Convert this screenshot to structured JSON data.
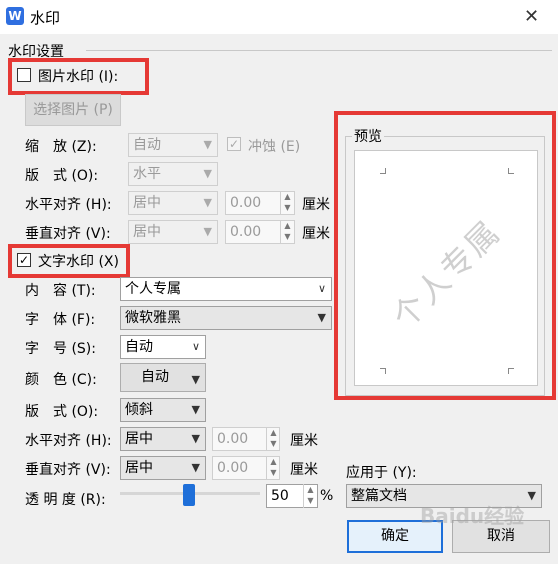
{
  "window": {
    "title": "水印",
    "app_icon": "W",
    "close": "✕"
  },
  "settings_group": {
    "title": "水印设置"
  },
  "picture_watermark": {
    "label": "图片水印 (I):",
    "checked": false,
    "select_picture_button": "选择图片 (P)",
    "scale_label": "缩　放 (Z):",
    "scale_value": "自动",
    "washout_label": "冲蚀 (E)",
    "washout_checked": true,
    "layout_label": "版　式 (O):",
    "layout_value": "水平",
    "h_align_label": "水平对齐 (H):",
    "h_align_value": "居中",
    "h_offset": "0.00",
    "h_unit": "厘米",
    "v_align_label": "垂直对齐 (V):",
    "v_align_value": "居中",
    "v_offset": "0.00",
    "v_unit": "厘米"
  },
  "text_watermark": {
    "label": "文字水印 (X)",
    "checked": true,
    "content_label": "内　容 (T):",
    "content_value": "个人专属",
    "font_label": "字　体 (F):",
    "font_value": "微软雅黑",
    "size_label": "字　号 (S):",
    "size_value": "自动",
    "color_label": "颜　色 (C):",
    "color_value": "自动",
    "layout_label": "版　式 (O):",
    "layout_value": "倾斜",
    "h_align_label": "水平对齐 (H):",
    "h_align_value": "居中",
    "h_offset": "0.00",
    "h_unit": "厘米",
    "v_align_label": "垂直对齐 (V):",
    "v_align_value": "居中",
    "v_offset": "0.00",
    "v_unit": "厘米",
    "transparency_label": "透 明 度 (R):",
    "transparency_value": "50",
    "transparency_unit": "%",
    "transparency_level_percent": 50
  },
  "preview": {
    "title": "预览",
    "watermark_text": "个人专属"
  },
  "apply_to": {
    "label": "应用于 (Y):",
    "value": "整篇文档"
  },
  "buttons": {
    "ok": "确定",
    "cancel": "取消"
  },
  "overlay": {
    "watermark_brand": "Baidu经验"
  },
  "colors": {
    "highlight": "#e53935",
    "accent": "#1e6fd9"
  }
}
